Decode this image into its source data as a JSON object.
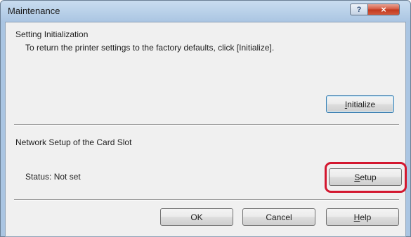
{
  "window": {
    "title": "Maintenance",
    "help_icon": "?",
    "close_icon": "×"
  },
  "initialization": {
    "heading": "Setting Initialization",
    "description": "To return the printer settings to the factory defaults, click [Initialize].",
    "button_label": "Initialize",
    "button_mnemonic": "I"
  },
  "network": {
    "heading": "Network Setup of the Card Slot",
    "status": "Status: Not set",
    "button_label": "Setup",
    "button_mnemonic": "S"
  },
  "footer": {
    "ok_label": "OK",
    "cancel_label": "Cancel",
    "help_label": "Help",
    "help_mnemonic": "H"
  },
  "colors": {
    "highlight": "#d3172f",
    "title_bar": "#b7cfe8",
    "dialog_bg": "#f0f0f0"
  }
}
